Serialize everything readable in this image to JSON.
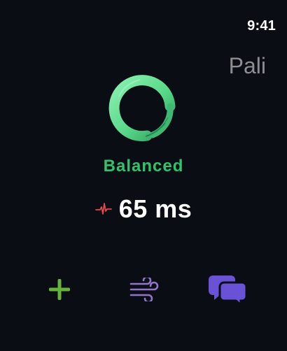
{
  "status_bar": {
    "time": "9:41"
  },
  "header": {
    "app_name": "Pali"
  },
  "hrv": {
    "status_label": "Balanced",
    "value": "65 ms"
  },
  "actions": {
    "add": {
      "icon": "plus-icon"
    },
    "breathe": {
      "icon": "wind-icon"
    },
    "chat": {
      "icon": "chat-bubbles-icon"
    }
  },
  "colors": {
    "background": "#0a0d13",
    "accent_green": "#2ec46b",
    "ring_green": "#6ee39c",
    "pulse_red": "#e5484d",
    "add_green": "#67b43a",
    "wind_purple": "#8f74c9",
    "chat_purple": "#6a52d6",
    "title_gray": "#8d8e92"
  }
}
